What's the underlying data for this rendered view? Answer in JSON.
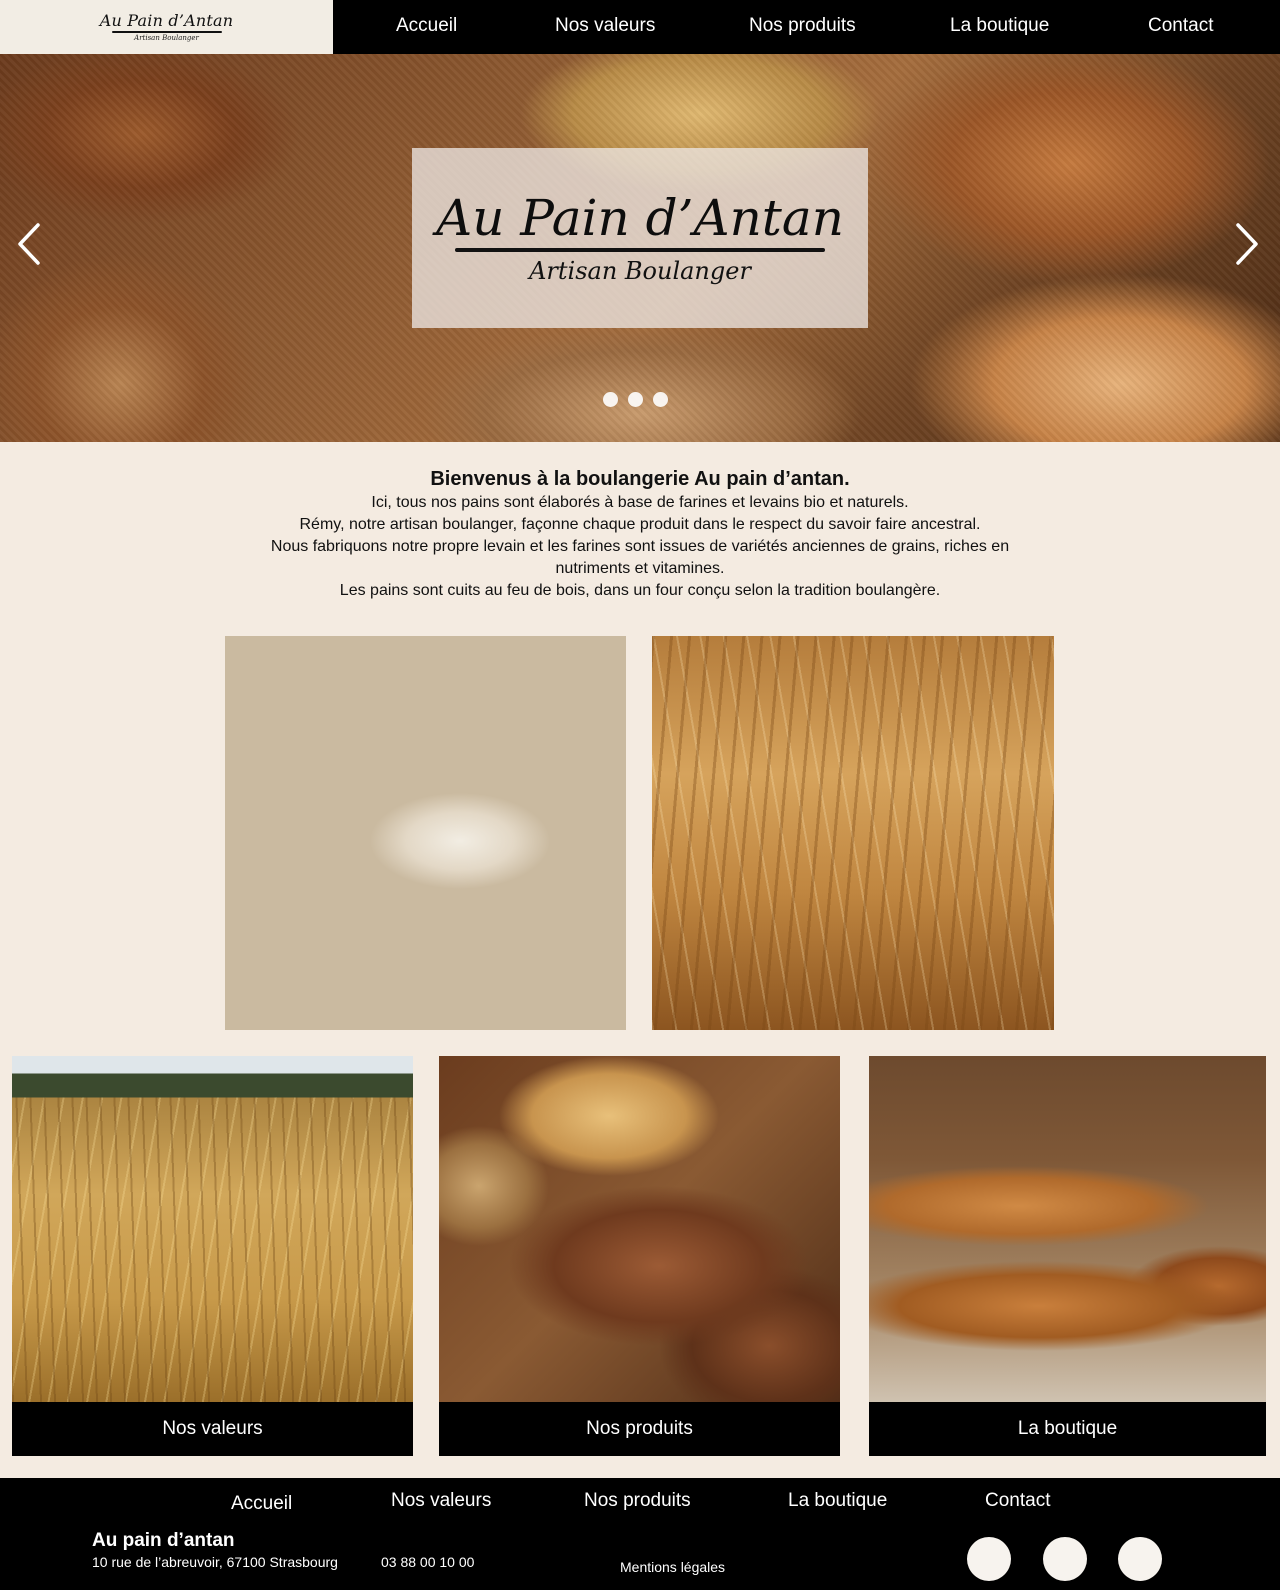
{
  "header": {
    "logo_main": "Au Pain d’Antan",
    "logo_sub": "Artisan Boulanger",
    "nav": [
      "Accueil",
      "Nos valeurs",
      "Nos produits",
      "La boutique",
      "Contact"
    ]
  },
  "hero": {
    "title": "Au Pain d’Antan",
    "subtitle": "Artisan Boulanger",
    "slides_total": 3
  },
  "intro": {
    "title": "Bienvenus à la boulangerie Au pain d’antan.",
    "lines": [
      "Ici, tous nos pains sont élaborés à base de farines et levains bio et naturels.",
      "Rémy, notre artisan boulanger, façonne chaque produit dans le respect du savoir faire ancestral.",
      "Nous fabriquons notre propre levain et les farines sont issues de variétés anciennes de grains, riches en",
      "nutriments et vitamines.",
      "Les pains sont cuits au feu de bois, dans un four conçu selon la tradition boulangère."
    ]
  },
  "cards": [
    "Nos valeurs",
    "Nos produits",
    "La boutique"
  ],
  "footer": {
    "nav": [
      "Accueil",
      "Nos valeurs",
      "Nos produits",
      "La boutique",
      "Contact"
    ],
    "name": "Au pain d’antan",
    "address": "10 rue de l’abreuvoir, 67100 Strasbourg",
    "phone": "03 88 00 10 00",
    "legal": "Mentions légales"
  },
  "colors": {
    "page_bg": "#f4ebe1",
    "bar_bg": "#000000",
    "text_light": "#ffffff"
  },
  "icons": [
    "chevron-left-icon",
    "chevron-right-icon"
  ]
}
